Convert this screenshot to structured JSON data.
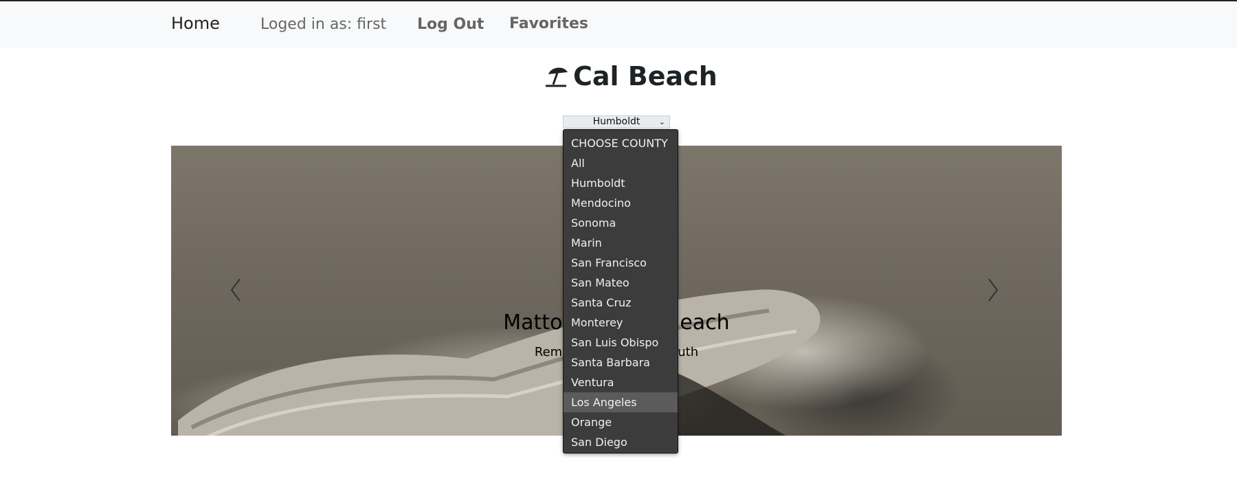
{
  "nav": {
    "home": "Home",
    "user": "Loged in as: first",
    "logout": "Log Out",
    "favorites": "Favorites"
  },
  "brand": {
    "title": "Cal Beach",
    "icon": "beach-umbrella-icon"
  },
  "county_select": {
    "selected": "Humboldt",
    "options": [
      "CHOOSE COUNTY",
      "All",
      "Humboldt",
      "Mendocino",
      "Sonoma",
      "Marin",
      "San Francisco",
      "San Mateo",
      "Santa Cruz",
      "Monterey",
      "San Luis Obispo",
      "Santa Barbara",
      "Ventura",
      "Los Angeles",
      "Orange",
      "San Diego"
    ],
    "highlighted": "Los Angeles"
  },
  "carousel": {
    "caption_title": "Mattol",
    "caption_title_end": "Beach",
    "caption_sub": "Remo",
    "caption_sub_end": "outh"
  },
  "colors": {
    "navbar_bg": "#f8f9fa",
    "dropdown_bg": "#3c3c3c",
    "dropdown_highlight": "#5b5b5b"
  }
}
